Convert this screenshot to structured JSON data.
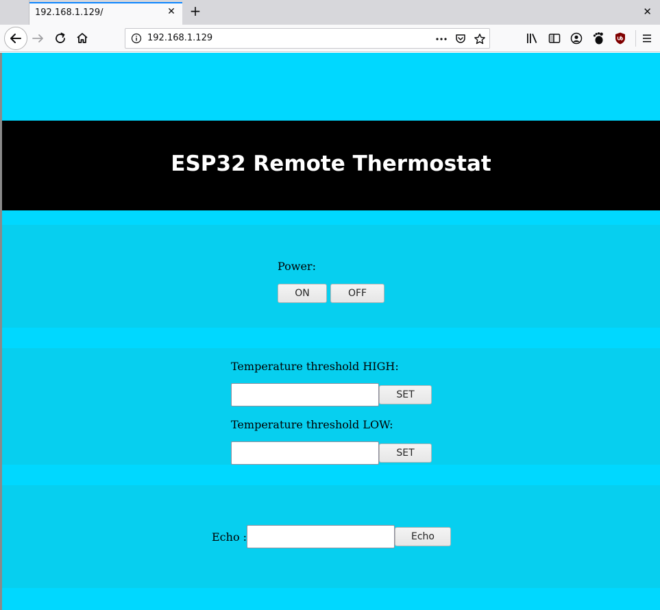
{
  "browser": {
    "tab_title": "192.168.1.129/",
    "url": "192.168.1.129",
    "tab_close_glyph": "✕",
    "new_tab_glyph": "+",
    "window_close_glyph": "✕"
  },
  "header": {
    "title": "ESP32 Remote Thermostat"
  },
  "power": {
    "label": "Power:",
    "on_label": "ON",
    "off_label": "OFF"
  },
  "thresholds": {
    "high_label": "Temperature threshold HIGH:",
    "high_value": "",
    "high_set_label": "SET",
    "low_label": "Temperature threshold LOW:",
    "low_value": "",
    "low_set_label": "SET"
  },
  "echo": {
    "label": "Echo :",
    "value": "",
    "button_label": "Echo"
  },
  "colors": {
    "page_background": "#00d8ff",
    "panel_background": "#07cfef",
    "header_background": "#000000",
    "header_text": "#ffffff",
    "tab_accent": "#0a84ff"
  },
  "icons": {
    "back": "back-arrow-icon",
    "forward": "forward-arrow-icon",
    "reload": "reload-icon",
    "home": "home-icon",
    "site_info": "info-icon",
    "page_actions": "more-icon",
    "pocket": "pocket-icon",
    "bookmark": "star-icon",
    "library": "library-icon",
    "sidebar": "sidebar-icon",
    "account": "account-icon",
    "gnome_extension": "gnome-foot-icon",
    "ublock": "ublock-shield-icon",
    "menu": "hamburger-menu-icon"
  }
}
